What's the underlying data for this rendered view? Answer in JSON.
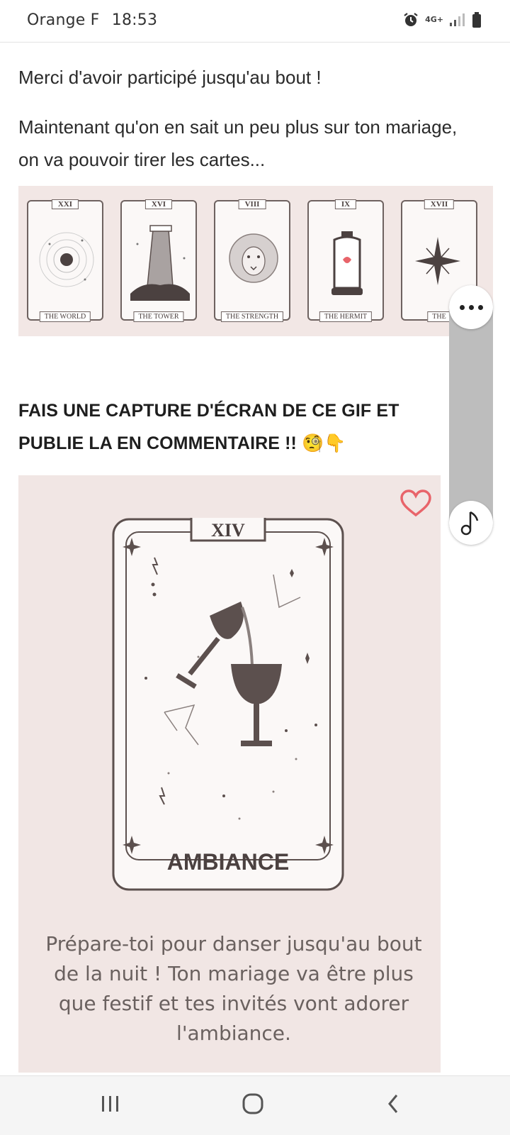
{
  "status_bar": {
    "carrier": "Orange F",
    "time": "18:53",
    "network": "4G+"
  },
  "content": {
    "intro": "Merci d'avoir participé jusqu'au bout !",
    "paragraph": "Maintenant qu'on en sait un peu plus sur ton mariage, on va pouvoir tirer les cartes...",
    "tarot_cards": [
      {
        "numeral": "XXI",
        "name": "THE WORLD"
      },
      {
        "numeral": "XVI",
        "name": "THE TOWER"
      },
      {
        "numeral": "VIII",
        "name": "THE STRENGTH"
      },
      {
        "numeral": "IX",
        "name": "THE HERMIT"
      },
      {
        "numeral": "XVII",
        "name": "THE"
      }
    ],
    "heading_line1": "FAIS UNE CAPTURE D'ÉCRAN DE CE GIF ET",
    "heading_line2": "PUBLIE LA EN COMMENTAIRE !! 🧐👇",
    "main_card": {
      "numeral": "XIV",
      "title": "AMBIANCE"
    },
    "description": "Prépare-toi pour danser jusqu'au bout de la nuit ! Ton mariage va être plus que festif et tes invités vont adorer l'ambiance."
  },
  "colors": {
    "banner_bg": "#f2e7e5",
    "card_line": "#5c504e",
    "heart": "#e8646a",
    "panel": "#bdbdbd"
  },
  "icons": {
    "menu": "more-dots-icon",
    "music": "music-note-icon",
    "heart": "heart-icon"
  }
}
